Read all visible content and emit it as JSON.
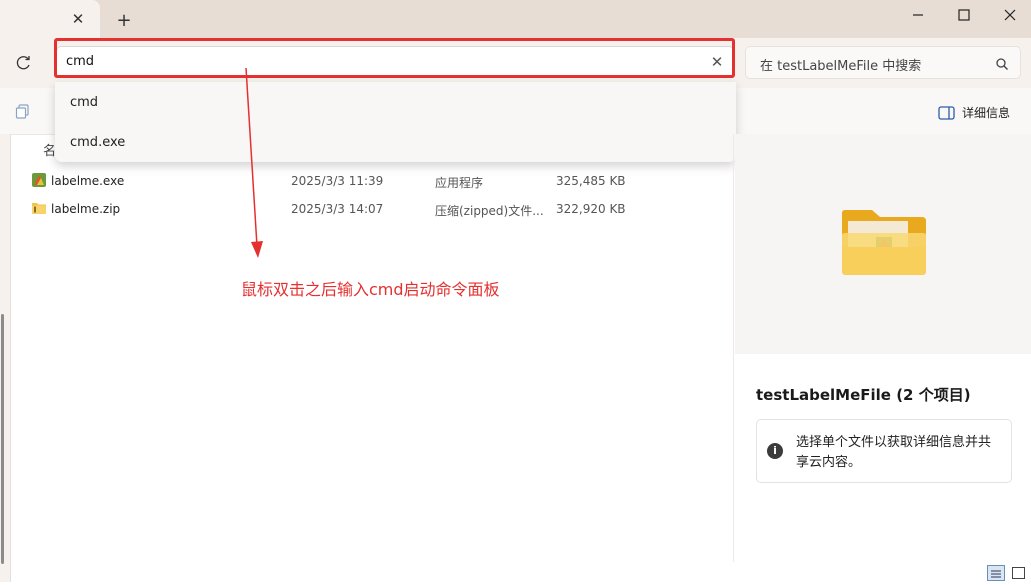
{
  "titlebar": {
    "close_tab_glyph": "✕",
    "new_tab_glyph": "+"
  },
  "address": {
    "value": "cmd",
    "clear_glyph": "✕"
  },
  "search": {
    "placeholder": "在 testLabelMeFile 中搜索"
  },
  "toolbar": {
    "details_label": "详细信息"
  },
  "dropdown": {
    "items": [
      "cmd",
      "cmd.exe"
    ]
  },
  "filelist": {
    "column_name_partial": "名",
    "rows": [
      {
        "name": "labelme.exe",
        "date": "2025/3/3 11:39",
        "type": "应用程序",
        "size": "325,485 KB"
      },
      {
        "name": "labelme.zip",
        "date": "2025/3/3 14:07",
        "type": "压缩(zipped)文件...",
        "size": "322,920 KB"
      }
    ]
  },
  "details_pane": {
    "title": "testLabelMeFile (2 个项目)",
    "info_glyph": "i",
    "info_text": "选择单个文件以获取详细信息并共享云内容。"
  },
  "annotation": {
    "text": "鼠标双击之后输入cmd启动命令面板",
    "color": "#e53030"
  }
}
